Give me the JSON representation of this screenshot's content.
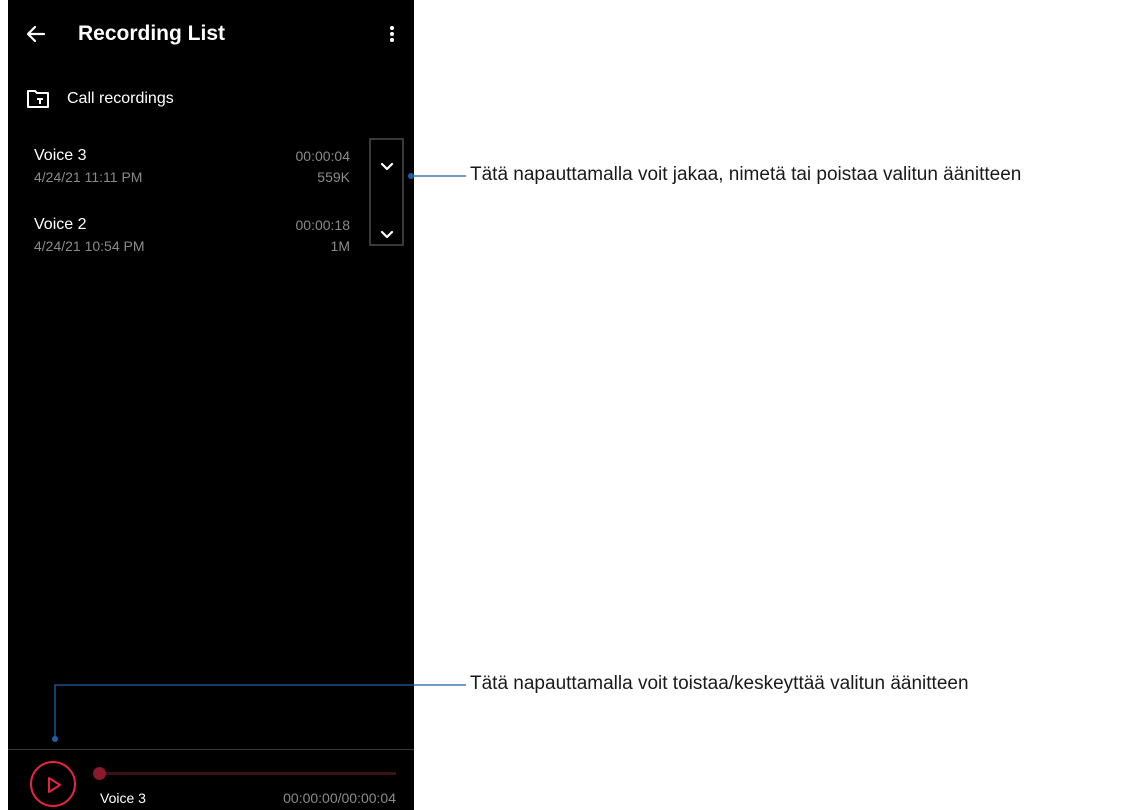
{
  "app": {
    "title": "Recording List",
    "back_icon": "arrow-left-icon",
    "more_icon": "more-vert-icon"
  },
  "folder": {
    "icon": "folder-call-icon",
    "label": "Call recordings"
  },
  "recordings": [
    {
      "name": "Voice 3",
      "date": "4/24/21 11:11 PM",
      "duration": "00:00:04",
      "size": "559K"
    },
    {
      "name": "Voice 2",
      "date": "4/24/21 10:54 PM",
      "duration": "00:00:18",
      "size": "1M"
    }
  ],
  "player": {
    "track_name": "Voice 3",
    "time": "00:00:00/00:00:04",
    "progress": 0.0,
    "accent_color": "#e5253f"
  },
  "annotations": {
    "expand_menu": "Tätä napauttamalla voit jakaa, nimetä tai poistaa valitun äänitteen",
    "play_pause": "Tätä napauttamalla voit toistaa/keskeyttää valitun äänitteen",
    "line_color": "#1f5fa8"
  }
}
